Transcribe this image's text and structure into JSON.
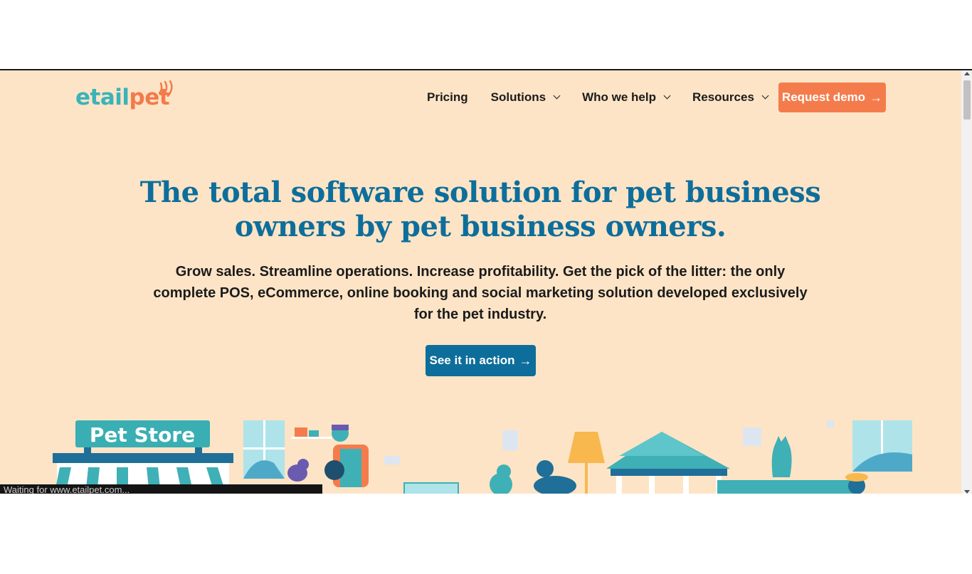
{
  "brand": {
    "logo_part1": "etail",
    "logo_part2": "pet"
  },
  "nav": {
    "items": [
      {
        "label": "Pricing",
        "dropdown": false
      },
      {
        "label": "Solutions",
        "dropdown": true
      },
      {
        "label": "Who we help",
        "dropdown": true
      },
      {
        "label": "Resources",
        "dropdown": true
      }
    ],
    "cta_label": "Request demo"
  },
  "hero": {
    "title": "The total software solution for pet business owners by pet business owners.",
    "subtitle": "Grow sales. Streamline operations. Increase profitability. Get the pick of the litter: the only complete POS, eCommerce, online booking and social marketing solution developed exclusively for the pet industry.",
    "cta_label": "See it in action"
  },
  "illustration": {
    "store_sign": "Pet Store"
  },
  "status_bar": {
    "text": "Waiting for www.etailpet.com..."
  },
  "colors": {
    "background": "#fde4c6",
    "primary": "#0d6e9b",
    "accent": "#f47c4c",
    "teal": "#3bb3b9"
  },
  "icons": {
    "arrow": "arrow-right-icon",
    "chevron": "chevron-down-icon"
  }
}
